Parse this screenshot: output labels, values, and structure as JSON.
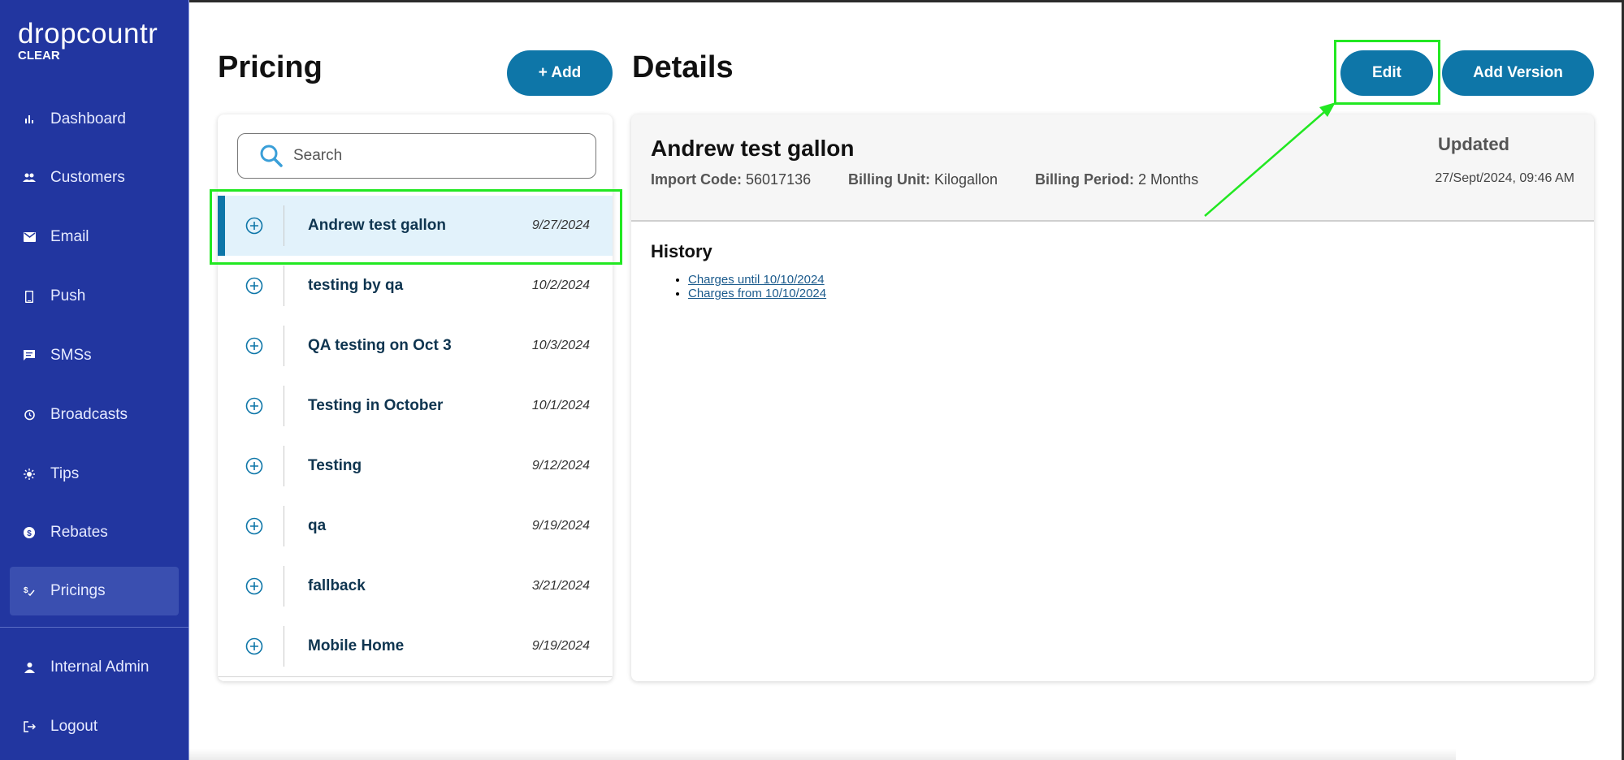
{
  "brand": {
    "name": "dropcountr",
    "subtitle": "CLEAR"
  },
  "sidebar": {
    "items": [
      {
        "label": "Dashboard",
        "icon": "bar-chart-icon"
      },
      {
        "label": "Customers",
        "icon": "people-icon"
      },
      {
        "label": "Email",
        "icon": "envelope-icon"
      },
      {
        "label": "Push",
        "icon": "phone-icon"
      },
      {
        "label": "SMSs",
        "icon": "chat-bubble-icon"
      },
      {
        "label": "Broadcasts",
        "icon": "history-icon"
      },
      {
        "label": "Tips",
        "icon": "sun-icon"
      },
      {
        "label": "Rebates",
        "icon": "dollar-circle-icon"
      },
      {
        "label": "Pricings",
        "icon": "pricing-icon",
        "active": true
      }
    ],
    "bottom_items": [
      {
        "label": "Internal Admin",
        "icon": "person-icon"
      },
      {
        "label": "Logout",
        "icon": "logout-icon"
      }
    ]
  },
  "pricing": {
    "title": "Pricing",
    "add_label": "+ Add",
    "search": {
      "placeholder": "Search",
      "value": ""
    },
    "rows": [
      {
        "name": "Andrew test gallon",
        "date": "9/27/2024",
        "selected": true
      },
      {
        "name": "testing by qa",
        "date": "10/2/2024"
      },
      {
        "name": "QA testing on Oct 3",
        "date": "10/3/2024"
      },
      {
        "name": "Testing in October",
        "date": "10/1/2024"
      },
      {
        "name": "Testing",
        "date": "9/12/2024"
      },
      {
        "name": "qa",
        "date": "9/19/2024"
      },
      {
        "name": "fallback",
        "date": "3/21/2024"
      },
      {
        "name": "Mobile Home",
        "date": "9/19/2024"
      }
    ]
  },
  "details": {
    "title": "Details",
    "edit_label": "Edit",
    "add_version_label": "Add Version",
    "name": "Andrew test gallon",
    "import_code_label": "Import Code:",
    "import_code": "56017136",
    "billing_unit_label": "Billing Unit:",
    "billing_unit": "Kilogallon",
    "billing_period_label": "Billing Period:",
    "billing_period": "2 Months",
    "updated_label": "Updated",
    "updated_time": "27/Sept/2024, 09:46 AM",
    "history_title": "History",
    "history": [
      "Charges until 10/10/2024",
      "Charges from 10/10/2024"
    ]
  },
  "colors": {
    "sidebar": "#2236a0",
    "accent": "#0e76a8",
    "annotation": "#22e822",
    "selected_row": "#e2f2fb"
  }
}
